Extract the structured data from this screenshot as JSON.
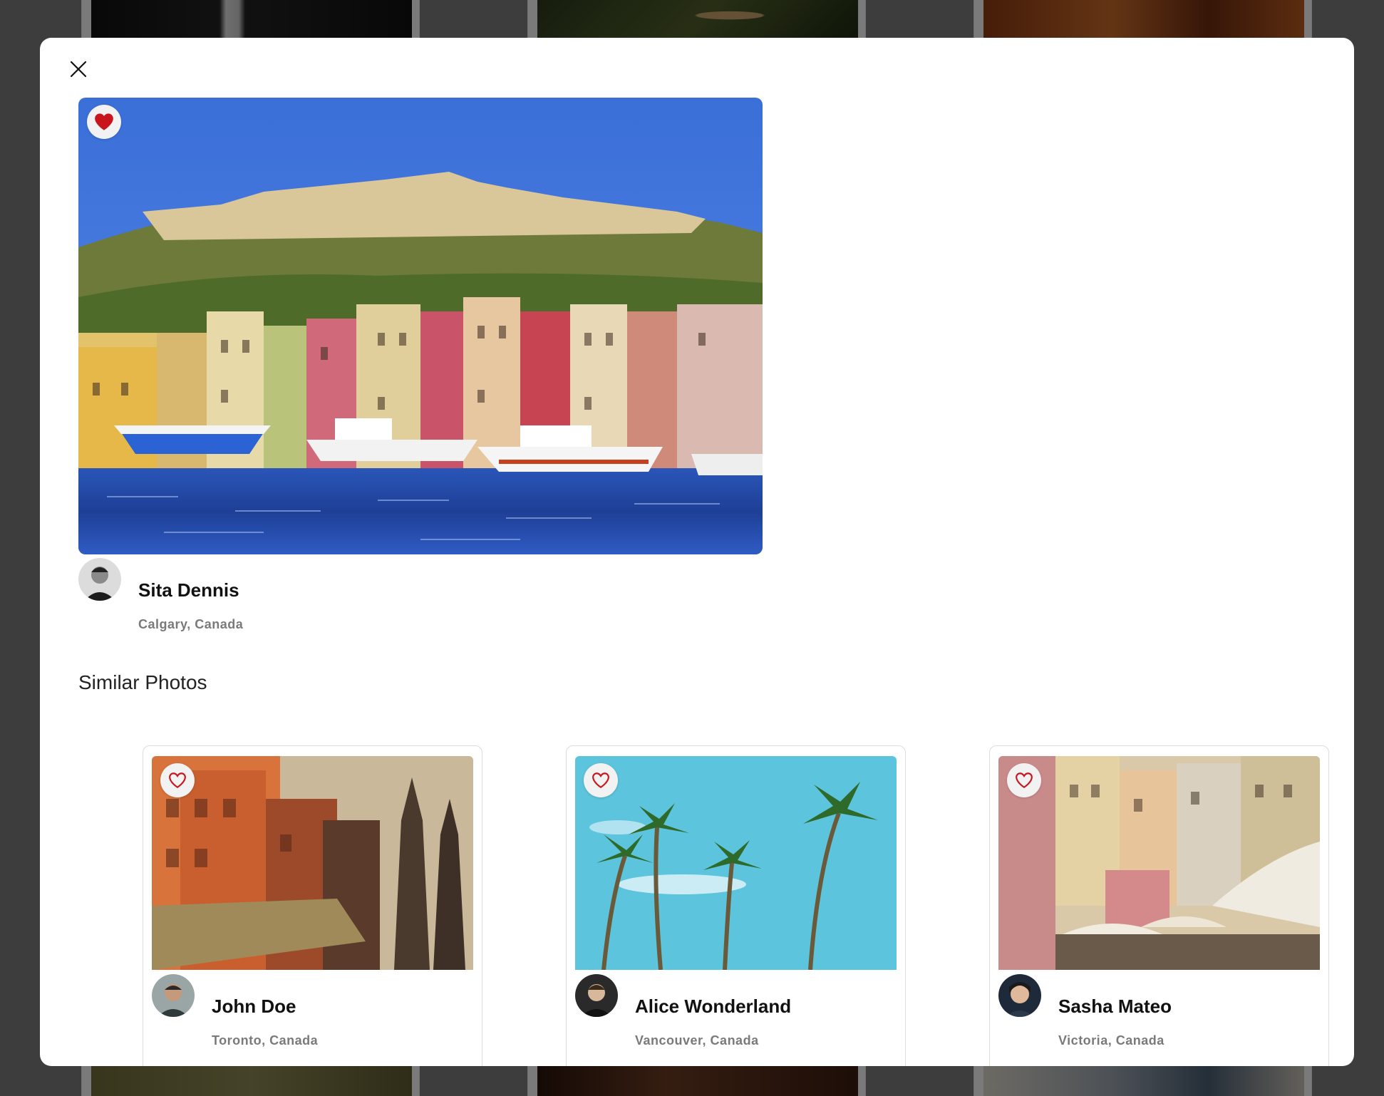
{
  "modal": {
    "close_icon": "close-icon",
    "hero": {
      "favorited": true,
      "heart_icon": "heart-filled-icon",
      "heart_color": "#c8161d",
      "author": {
        "name": "Sita Dennis",
        "location": "Calgary, Canada"
      }
    },
    "similar_title": "Similar Photos",
    "similar": [
      {
        "author": {
          "name": "John Doe",
          "location": "Toronto, Canada"
        },
        "favorited": false,
        "heart_icon": "heart-outline-icon"
      },
      {
        "author": {
          "name": "Alice Wonderland",
          "location": "Vancouver, Canada"
        },
        "favorited": false,
        "heart_icon": "heart-outline-icon"
      },
      {
        "author": {
          "name": "Sasha Mateo",
          "location": "Victoria, Canada"
        },
        "favorited": false,
        "heart_icon": "heart-outline-icon"
      }
    ]
  },
  "colors": {
    "heart": "#c8161d",
    "overlay": "rgba(0,0,0,0.5)",
    "name_text": "#111111",
    "location_text": "#7a7a7a"
  }
}
